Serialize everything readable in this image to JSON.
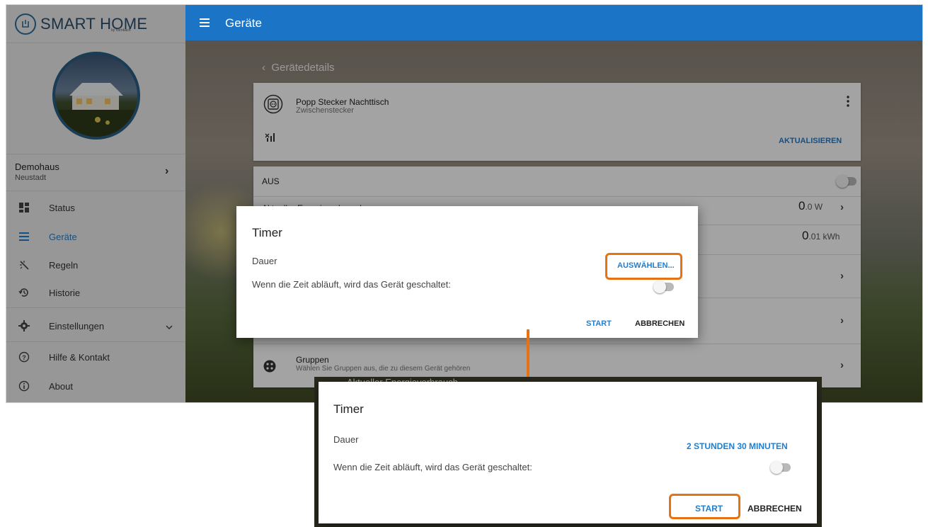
{
  "brand": {
    "name": "SMART HOME",
    "sub": "by hornbach"
  },
  "header": {
    "title": "Geräte"
  },
  "home": {
    "name": "Demohaus",
    "city": "Neustadt"
  },
  "nav": [
    {
      "label": "Status",
      "icon": "dashboard-icon"
    },
    {
      "label": "Geräte",
      "icon": "list-icon",
      "active": true
    },
    {
      "label": "Regeln",
      "icon": "rules-wand-icon"
    },
    {
      "label": "Historie",
      "icon": "history-icon"
    },
    {
      "label": "Einstellungen",
      "icon": "gear-icon"
    },
    {
      "label": "Hilfe & Kontakt",
      "icon": "help-icon"
    },
    {
      "label": "About",
      "icon": "info-icon"
    }
  ],
  "breadcrumb": "Gerätedetails",
  "device": {
    "name": "Popp Stecker Nachttisch",
    "type": "Zwischenstecker",
    "refresh_label": "AKTUALISIEREN"
  },
  "state_row": {
    "label": "AUS"
  },
  "energy_row": {
    "label": "Aktueller Energieverbrauch",
    "value": "0",
    "unit_value": ".0 W"
  },
  "total_row": {
    "value": "0",
    "unit_value": ".01 kWh"
  },
  "groups_row": {
    "title": "Gruppen",
    "subtitle": "Wählen Sie Gruppen aus, die zu diesem Gerät gehören"
  },
  "dialog1": {
    "title": "Timer",
    "duration_label": "Dauer",
    "duration_value": "AUSWÄHLEN...",
    "switch_text": "Wenn die Zeit abläuft, wird das Gerät geschaltet:",
    "start": "START",
    "cancel": "ABBRECHEN"
  },
  "dialog2": {
    "peek_text": "Aktueller Energieverbrauch",
    "title": "Timer",
    "duration_label": "Dauer",
    "duration_value": "2 STUNDEN 30 MINUTEN",
    "switch_text": "Wenn die Zeit abläuft, wird das Gerät geschaltet:",
    "start": "START",
    "cancel": "ABBRECHEN"
  },
  "colors": {
    "header": "#1c74c6",
    "accent": "#1e7fd1",
    "highlight": "#e67313"
  }
}
